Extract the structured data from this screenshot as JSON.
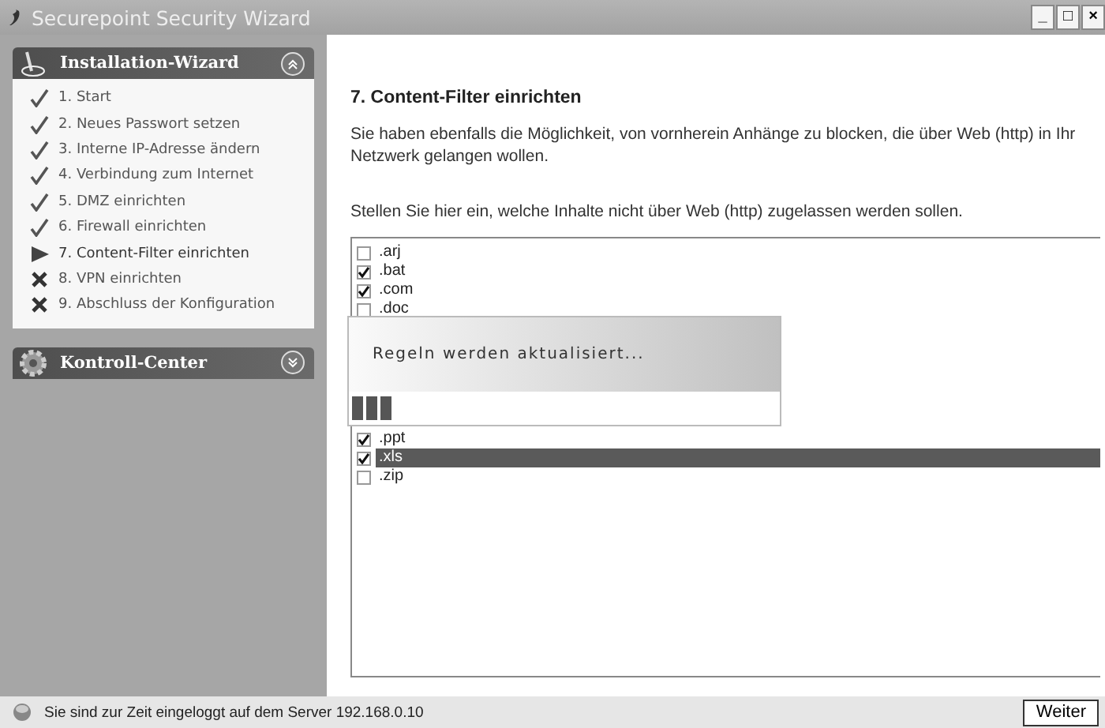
{
  "window": {
    "title": "Securepoint Security Wizard",
    "controls": [
      "_",
      "□",
      "×"
    ]
  },
  "sidebar": {
    "panels": [
      {
        "title": "Installation-Wizard",
        "expanded": true,
        "kind": "wizard",
        "items": [
          {
            "label": "1. Start",
            "kind": "done"
          },
          {
            "label": "2. Neues Passwort setzen",
            "kind": "done"
          },
          {
            "label": "3. Interne IP-Adresse ändern",
            "kind": "done"
          },
          {
            "label": "4. Verbindung zum Internet",
            "kind": "done"
          },
          {
            "label": "5. DMZ einrichten",
            "kind": "done"
          },
          {
            "label": "6. Firewall einrichten",
            "kind": "done"
          },
          {
            "label": "7. Content-Filter einrichten",
            "kind": "current"
          },
          {
            "label": "8. VPN einrichten",
            "kind": "pending"
          },
          {
            "label": "9. Abschluss der Konfiguration",
            "kind": "pending"
          }
        ]
      },
      {
        "title": "Kontroll-Center",
        "expanded": false,
        "kind": "control"
      }
    ]
  },
  "content": {
    "heading": "7.  Content-Filter einrichten",
    "intro": "Sie haben ebenfalls die Möglichkeit, von vornherein Anhänge zu blocken, die über Web (http) in Ihr Netzwerk gelangen wollen.",
    "prompt": "Stellen Sie hier ein, welche Inhalte nicht über Web (http) zugelassen werden sollen.",
    "file_types": [
      {
        "label": ".arj",
        "checked": false,
        "selected": false
      },
      {
        "label": ".bat",
        "checked": true,
        "selected": false
      },
      {
        "label": ".com",
        "checked": true,
        "selected": false
      },
      {
        "label": ".doc",
        "checked": false,
        "selected": false
      },
      {
        "label": ".ppt",
        "checked": true,
        "selected": false
      },
      {
        "label": ".xls",
        "checked": true,
        "selected": true
      },
      {
        "label": ".zip",
        "checked": false,
        "selected": false
      }
    ]
  },
  "progress_dialog": {
    "message": "Regeln werden aktualisiert...",
    "level": 0.1
  },
  "status_bar": {
    "text": "Sie sind zur Zeit eingeloggt auf dem Server 192.168.0.10",
    "button": "Weiter"
  }
}
